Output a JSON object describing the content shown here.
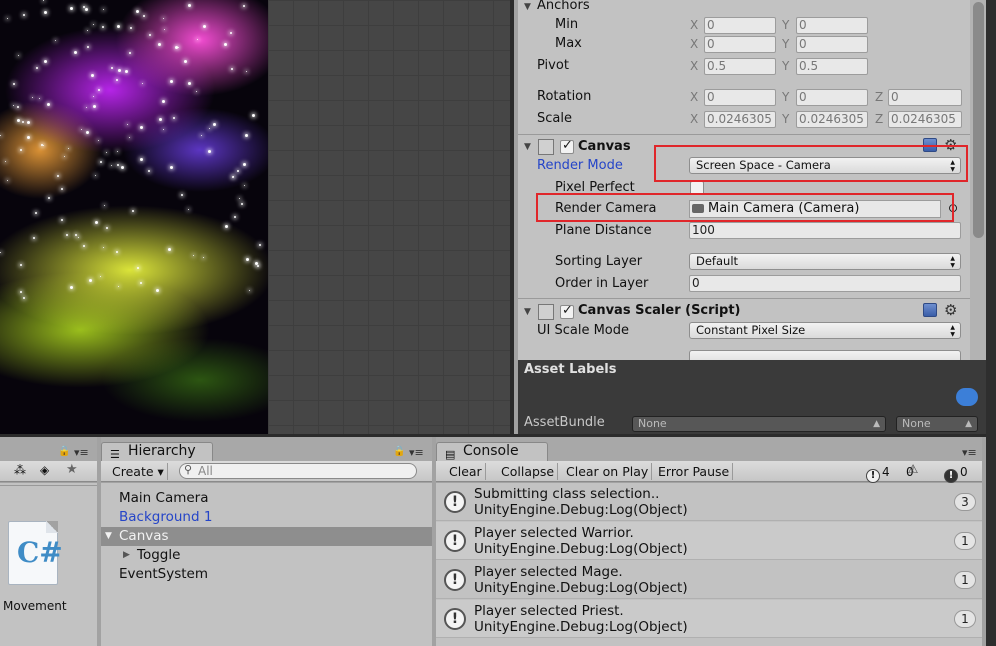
{
  "inspector": {
    "anchors_label": "Anchors",
    "min_label": "Min",
    "max_label": "Max",
    "pivot_label": "Pivot",
    "rotation_label": "Rotation",
    "scale_label": "Scale",
    "axis_x": "X",
    "axis_y": "Y",
    "axis_z": "Z",
    "anchors_min_x": "0",
    "anchors_min_y": "0",
    "anchors_max_x": "0",
    "anchors_max_y": "0",
    "pivot_x": "0.5",
    "pivot_y": "0.5",
    "rotation_x": "0",
    "rotation_y": "0",
    "rotation_z": "0",
    "scale_x": "0.0246305",
    "scale_y": "0.0246305",
    "scale_z": "0.0246305",
    "canvas": {
      "title": "Canvas",
      "render_mode_label": "Render Mode",
      "render_mode_value": "Screen Space - Camera",
      "pixel_perfect_label": "Pixel Perfect",
      "render_camera_label": "Render Camera",
      "render_camera_value": "Main Camera (Camera)",
      "plane_distance_label": "Plane Distance",
      "plane_distance_value": "100",
      "sorting_layer_label": "Sorting Layer",
      "sorting_layer_value": "Default",
      "order_in_layer_label": "Order in Layer",
      "order_in_layer_value": "0"
    },
    "canvas_scaler": {
      "title": "Canvas Scaler (Script)",
      "ui_scale_mode_label": "UI Scale Mode",
      "ui_scale_mode_value": "Constant Pixel Size"
    }
  },
  "asset_labels": {
    "title": "Asset Labels",
    "bundle_label": "AssetBundle",
    "bundle_value": "None",
    "variant_value": "None"
  },
  "hierarchy": {
    "tab_label": "Hierarchy",
    "create_label": "Create",
    "search_placeholder": "All",
    "items": [
      {
        "label": "Main Camera"
      },
      {
        "label": "Background 1"
      },
      {
        "label": "Canvas"
      },
      {
        "label": "Toggle"
      },
      {
        "label": "EventSystem"
      }
    ]
  },
  "console": {
    "tab_label": "Console",
    "buttons": [
      "Clear",
      "Collapse",
      "Clear on Play",
      "Error Pause"
    ],
    "info_count": "4",
    "warning_count": "0",
    "error_count": "0",
    "logs": [
      {
        "message": "Submitting class selection..",
        "source": "UnityEngine.Debug:Log(Object)",
        "count": "3"
      },
      {
        "message": "Player selected Warrior.",
        "source": "UnityEngine.Debug:Log(Object)",
        "count": "1"
      },
      {
        "message": "Player selected Mage.",
        "source": "UnityEngine.Debug:Log(Object)",
        "count": "1"
      },
      {
        "message": "Player selected Priest.",
        "source": "UnityEngine.Debug:Log(Object)",
        "count": "1"
      }
    ]
  },
  "project": {
    "asset_name": "Movement",
    "asset_glyph": "C#"
  },
  "colors": {
    "highlight": "#e0262a",
    "link_blue": "#2545c8"
  }
}
